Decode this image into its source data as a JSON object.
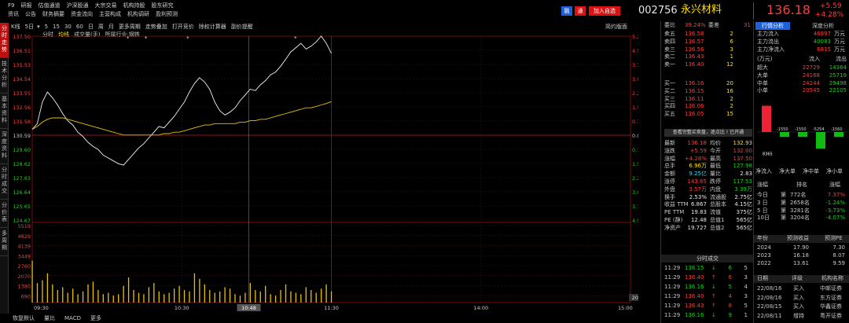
{
  "menu1": [
    "F9",
    "研报",
    "估值通道",
    "沪深股通",
    "大宗交易",
    "机构持股",
    "股东研究"
  ],
  "menu2": [
    "资讯",
    "公告",
    "财务摘要",
    "资金流向",
    "主营构成",
    "机构调研",
    "盈利预测"
  ],
  "left_nav": [
    "分时走势",
    "技术分析",
    "基本资料",
    "深度资料",
    "分时成交",
    "分价表",
    "多周期"
  ],
  "left_nav_active": 0,
  "toolbar": [
    "K线",
    "5日",
    "5",
    "15",
    "30",
    "60",
    "日",
    "周",
    "月",
    "更多周期",
    "走势叠加",
    "打开竞价",
    "除权计算器",
    "副价提醒"
  ],
  "toolbar_right": "简约版面",
  "tabs": [
    "分时",
    "均线",
    "成交量(手)",
    "所属行业:钢铁"
  ],
  "stock": {
    "code": "002756",
    "name": "永兴材料",
    "price": "136.18",
    "change": "+5.59",
    "pct": "+4.28%",
    "btn_rong": "融",
    "btn_tong": "通",
    "btn_add": "加入自选"
  },
  "price_axis": {
    "left": [
      "137.50",
      "136.51",
      "135.53",
      "134.54",
      "133.55",
      "132.56",
      "131.58",
      "130.59",
      "129.60",
      "128.62",
      "127.63",
      "126.64",
      "125.65",
      "124.67"
    ],
    "right": [
      "5.29%",
      "4.54%",
      "3.78%",
      "3.02%",
      "2.27%",
      "1.51%",
      "0.76%",
      "0.00%",
      "0.76%",
      "1.51%",
      "2.27%",
      "3.02%",
      "3.78%",
      "4.54%"
    ]
  },
  "vol_axis": [
    "5519",
    "4829",
    "4139",
    "3449",
    "2760",
    "2070",
    "1380",
    "690"
  ],
  "time_axis": [
    "09:30",
    "10:30",
    "11:30",
    "14:00",
    "15:00"
  ],
  "time_hover": "10:48",
  "vol_badge": "209",
  "bottom_tabs": [
    "恢复默认",
    "量比",
    "MACD",
    "更多"
  ],
  "orderbook": {
    "webi_label": "委比",
    "webi": "39.24%",
    "weicha_label": "委差",
    "weicha": "31",
    "sells": [
      [
        "卖五",
        "136.58",
        "2"
      ],
      [
        "卖四",
        "136.57",
        "6"
      ],
      [
        "卖三",
        "136.56",
        "3"
      ],
      [
        "卖二",
        "136.43",
        "1"
      ],
      [
        "卖一",
        "136.40",
        "12"
      ]
    ],
    "buys": [
      [
        "买一",
        "136.16",
        "20"
      ],
      [
        "买二",
        "136.15",
        "16"
      ],
      [
        "买三",
        "136.11",
        "2"
      ],
      [
        "买四",
        "136.06",
        "2"
      ],
      [
        "买五",
        "136.05",
        "15"
      ]
    ],
    "banner": "查看完整买卖盘，逐点比 !  已开通"
  },
  "stats": [
    [
      "最新",
      "136.18",
      "均价",
      "132.93"
    ],
    [
      "涨跌",
      "+5.59",
      "今开",
      "132.00"
    ],
    [
      "涨幅",
      "+4.28%",
      "最高",
      "137.50"
    ],
    [
      "总手",
      "6.96万",
      "最低",
      "127.98"
    ],
    [
      "金额",
      "9.25亿",
      "量比",
      "2.83"
    ],
    [
      "涨停",
      "143.65",
      "跌停",
      "117.53"
    ],
    [
      "外盘",
      "3.57万",
      "内盘",
      "3.39万"
    ],
    [
      "换手",
      "2.53%",
      "流通股",
      "2.75亿"
    ],
    [
      "收益 TTM",
      "6.867",
      "总股本",
      "4.15亿"
    ],
    [
      "PE TTM",
      "19.83",
      "流值",
      "375亿"
    ],
    [
      "PE (静)",
      "12.48",
      "总值1",
      "565亿"
    ],
    [
      "净资产",
      "19.727",
      "总值2",
      "565亿"
    ]
  ],
  "ticks_title": "分时成交",
  "ticks": [
    [
      "11:29",
      "136.15",
      "↓",
      "6",
      "5"
    ],
    [
      "11:29",
      "136.40",
      "↑",
      "6",
      "3"
    ],
    [
      "11:29",
      "136.16",
      "↓",
      "5",
      "4"
    ],
    [
      "11:29",
      "136.40",
      "↑",
      "4",
      "3"
    ],
    [
      "11:29",
      "136.43",
      "↑",
      "8",
      "5"
    ],
    [
      "11:29",
      "136.16",
      "↓",
      "9",
      "1"
    ]
  ],
  "fund": {
    "tabs": [
      "行情分析",
      "深度分析"
    ],
    "rows": [
      [
        "主力流入",
        "46897",
        "万元"
      ],
      [
        "主力流出",
        "40083",
        "万元"
      ],
      [
        "主力净流入",
        "6815",
        "万元"
      ]
    ],
    "head": [
      "(万元)",
      "流入",
      "流出"
    ],
    "table": [
      [
        "超大",
        "22729",
        "14364"
      ],
      [
        "大单",
        "24168",
        "25719"
      ],
      [
        "中单",
        "24244",
        "29498"
      ],
      [
        "小单",
        "20545",
        "22105"
      ]
    ],
    "bars": [
      {
        "value": "8365",
        "amount": 8365
      },
      {
        "value": "-1550",
        "amount": -1550
      },
      {
        "value": "-1550",
        "amount": -1550
      },
      {
        "value": "-5254",
        "amount": -5254
      },
      {
        "value": "-1560",
        "amount": -1560
      }
    ],
    "bar_labels": [
      "净流入",
      "净大单",
      "净中单",
      "净小单"
    ]
  },
  "rank": {
    "head": [
      "涨幅",
      "",
      "排名",
      "涨幅"
    ],
    "rows": [
      [
        "今日",
        "第",
        "772名",
        "7.37%"
      ],
      [
        "3 日",
        "第",
        "2658名",
        "-1.24%"
      ],
      [
        "5 日",
        "第",
        "3281名",
        "-3.73%"
      ],
      [
        "10日",
        "第",
        "3204名",
        "-4.07%"
      ]
    ]
  },
  "forecast": {
    "head": [
      "年份",
      "预测收益",
      "预测PE"
    ],
    "rows": [
      [
        "2024",
        "17.90",
        "7.30"
      ],
      [
        "2023",
        "16.18",
        "8.07"
      ],
      [
        "2022",
        "13.61",
        "9.59"
      ]
    ]
  },
  "ratings": {
    "head": [
      "日期",
      "评级",
      "机构名称"
    ],
    "rows": [
      [
        "22/08/16",
        "买入",
        "中邮证券"
      ],
      [
        "22/08/16",
        "买入",
        "东方证券"
      ],
      [
        "22/08/15",
        "买入",
        "华鑫证券"
      ],
      [
        "22/08/11",
        "增持",
        "粤开证券"
      ]
    ]
  },
  "series": {
    "price": [
      131.0,
      131.4,
      132.9,
      133.6,
      133.2,
      132.7,
      132.1,
      131.6,
      131.3,
      130.8,
      130.5,
      130.1,
      129.8,
      129.6,
      129.2,
      129.0,
      128.8,
      128.6,
      128.5,
      128.9,
      129.3,
      129.7,
      130.0,
      130.4,
      130.8,
      131.2,
      131.1,
      131.5,
      131.9,
      132.4,
      132.9,
      133.6,
      134.2,
      134.6,
      134.3,
      133.8,
      132.9,
      132.3,
      132.0,
      132.2,
      132.5,
      133.0,
      133.4,
      133.8,
      133.7,
      134.1,
      134.4,
      134.8,
      135.0,
      135.4,
      135.9,
      136.4,
      136.7,
      137.0,
      136.6,
      136.8,
      137.1,
      137.5,
      137.0,
      136.3
    ],
    "avg": [
      131.0,
      131.2,
      131.5,
      131.7,
      131.8,
      131.8,
      131.8,
      131.7,
      131.6,
      131.5,
      131.4,
      131.3,
      131.2,
      131.1,
      131.0,
      130.9,
      130.8,
      130.7,
      130.6,
      130.6,
      130.6,
      130.6,
      130.6,
      130.6,
      130.6,
      130.6,
      130.7,
      130.7,
      130.8,
      130.8,
      130.9,
      131.0,
      131.1,
      131.2,
      131.3,
      131.3,
      131.4,
      131.4,
      131.4,
      131.4,
      131.4,
      131.5,
      131.5,
      131.6,
      131.6,
      131.7,
      131.7,
      131.8,
      131.9,
      132.0,
      132.1,
      132.2,
      132.3,
      132.4,
      132.5,
      132.5,
      132.6,
      132.7,
      132.8,
      132.93
    ],
    "volume": [
      3000,
      1400,
      1600,
      2100,
      1300,
      900,
      1100,
      700,
      1000,
      600,
      800,
      1300,
      1500,
      900,
      600,
      700,
      500,
      600,
      1200,
      1800,
      900,
      700,
      600,
      1100,
      1400,
      800,
      600,
      700,
      1000,
      1200,
      900,
      800,
      2100,
      1700,
      1300,
      900,
      700,
      800,
      1100,
      1000,
      600,
      500,
      700,
      1400,
      900,
      800,
      1200,
      600,
      500,
      900,
      1300,
      800,
      700,
      600,
      1100,
      900,
      700,
      1000,
      1300,
      800
    ]
  }
}
